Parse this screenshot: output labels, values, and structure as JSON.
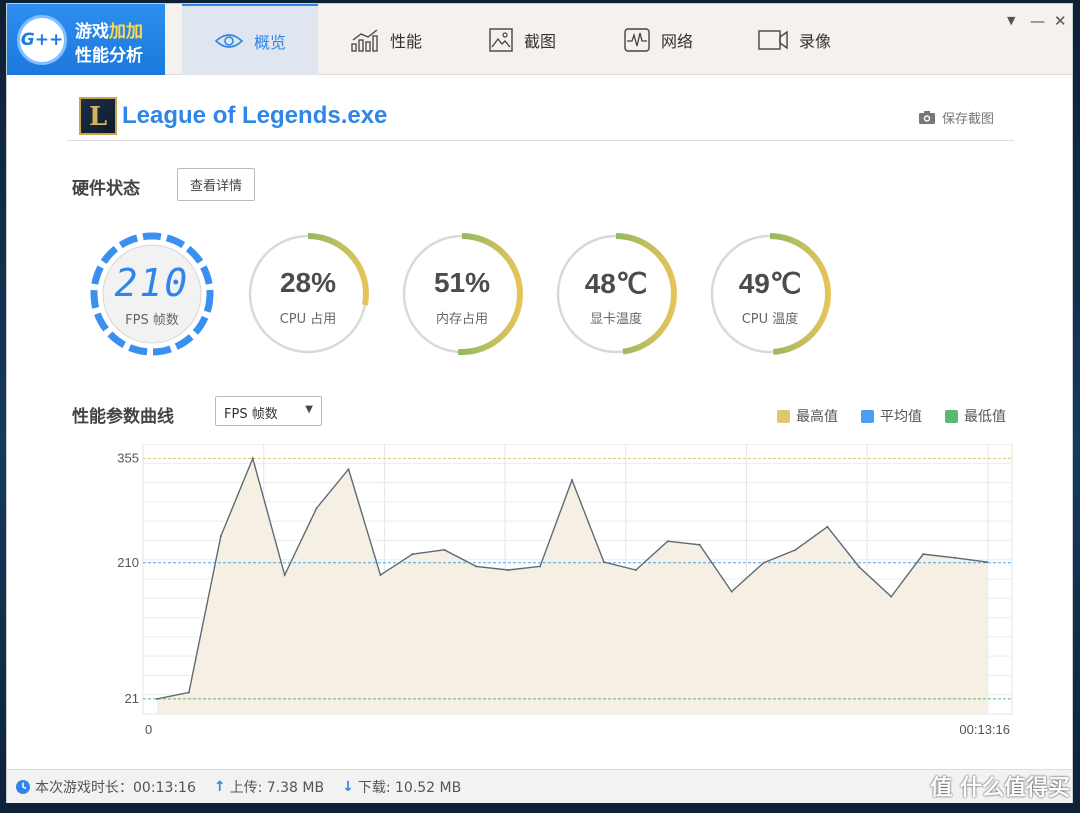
{
  "app": {
    "logo_badge": "G++",
    "title_line1_a": "游戏",
    "title_line1_b": "加加",
    "title_line2": "性能分析"
  },
  "tabs": [
    {
      "label": "概览",
      "icon": "eye-icon",
      "active": true
    },
    {
      "label": "性能",
      "icon": "performance-chart-icon",
      "active": false
    },
    {
      "label": "截图",
      "icon": "image-icon",
      "active": false
    },
    {
      "label": "网络",
      "icon": "network-pulse-icon",
      "active": false
    },
    {
      "label": "录像",
      "icon": "video-camera-icon",
      "active": false
    }
  ],
  "window_controls": {
    "menu": "▼",
    "minimize": "—",
    "close": "✕"
  },
  "game": {
    "icon_letter": "L",
    "title": "League of Legends.exe",
    "save_screenshot": "保存截图"
  },
  "hardware": {
    "title": "硬件状态",
    "details_button": "查看详情",
    "fps": {
      "value": "210",
      "label": "FPS 帧数"
    },
    "gauges": [
      {
        "value": "28%",
        "label": "CPU 占用",
        "fraction": 0.28
      },
      {
        "value": "51%",
        "label": "内存占用",
        "fraction": 0.51
      },
      {
        "value": "48℃",
        "label": "显卡温度",
        "fraction": 0.48
      },
      {
        "value": "49℃",
        "label": "CPU 温度",
        "fraction": 0.49
      }
    ]
  },
  "curve": {
    "title": "性能参数曲线",
    "select_value": "FPS 帧数",
    "legend": [
      {
        "label": "最高值",
        "color": "#e3c56e"
      },
      {
        "label": "平均值",
        "color": "#4a9ff0"
      },
      {
        "label": "最低值",
        "color": "#5cb870"
      }
    ]
  },
  "chart_data": {
    "type": "area",
    "x_start_label": "0",
    "x_end_label": "00:13:16",
    "y_ticks": [
      21,
      210,
      355
    ],
    "ylim": [
      0,
      375
    ],
    "max_line": 355,
    "avg_line": 210,
    "min_line": 21,
    "values": [
      21,
      30,
      247,
      355,
      193,
      286,
      340,
      193,
      222,
      228,
      205,
      200,
      205,
      325,
      211,
      200,
      240,
      235,
      170,
      210,
      228,
      260,
      204,
      163,
      222,
      217,
      211
    ]
  },
  "status": {
    "playtime": "本次游戏时长：00:13:16",
    "upload": "上传: 7.38 MB",
    "download": "下载: 10.52 MB"
  },
  "watermark": "值 什么值得买"
}
